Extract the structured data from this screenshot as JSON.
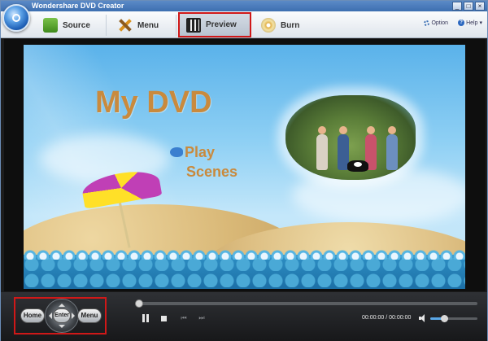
{
  "window": {
    "title": "Wondershare DVD Creator",
    "controls": {
      "minimize": "_",
      "maximize": "□",
      "close": "×"
    }
  },
  "toolbar": {
    "tabs": [
      {
        "label": "Source",
        "icon": "source-icon"
      },
      {
        "label": "Menu",
        "icon": "menu-icon"
      },
      {
        "label": "Preview",
        "icon": "preview-icon",
        "active": true
      },
      {
        "label": "Burn",
        "icon": "burn-icon"
      }
    ],
    "option_label": "Option",
    "help_label": "Help",
    "help_arrow": "▾"
  },
  "preview": {
    "title": "My DVD",
    "play_label": "Play",
    "scenes_label": "Scenes"
  },
  "navigation": {
    "home_label": "Home",
    "enter_label": "Enter",
    "menu_label": "Menu"
  },
  "playback": {
    "current_time": "00:00:00",
    "separator": "/",
    "total_time": "00:00:00",
    "progress": 0,
    "volume": 0.3
  },
  "colors": {
    "accent_highlight": "#d01818",
    "title_text": "#c98a3d",
    "volume_fill": "#5aa8e8"
  }
}
